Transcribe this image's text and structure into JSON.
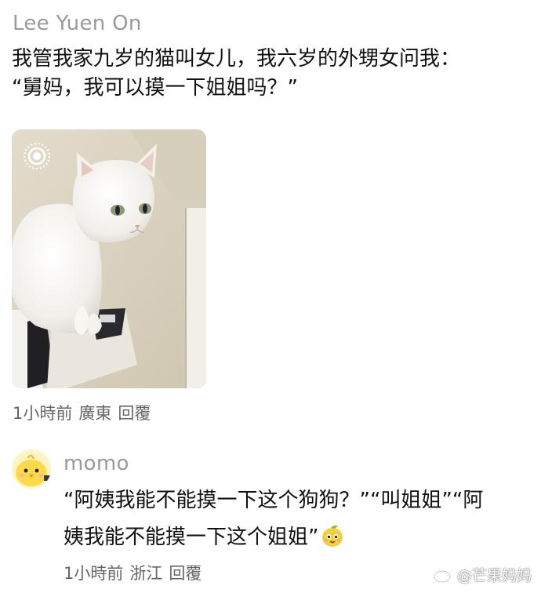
{
  "comment1": {
    "username": "Lee Yuen On",
    "line1": "我管我家九岁的猫叫女儿，我六岁的外甥女问我：",
    "line2": "“舅妈，我可以摸一下姐姐吗？”",
    "photo_icon": "live-photo-icon",
    "time": "1小時前",
    "location": "廣東",
    "reply": "回覆"
  },
  "comment2": {
    "username": "momo",
    "line1": "“阿姨我能不能摸一下这个狗狗？”“叫姐姐”“阿",
    "line2": "姨我能不能摸一下这个姐姐”",
    "emoji": "mango-emoji",
    "time": "1小時前",
    "location": "浙江",
    "reply": "回覆"
  },
  "watermark": {
    "text": "@芒果妈妈",
    "icon": "weibo-logo-icon"
  }
}
